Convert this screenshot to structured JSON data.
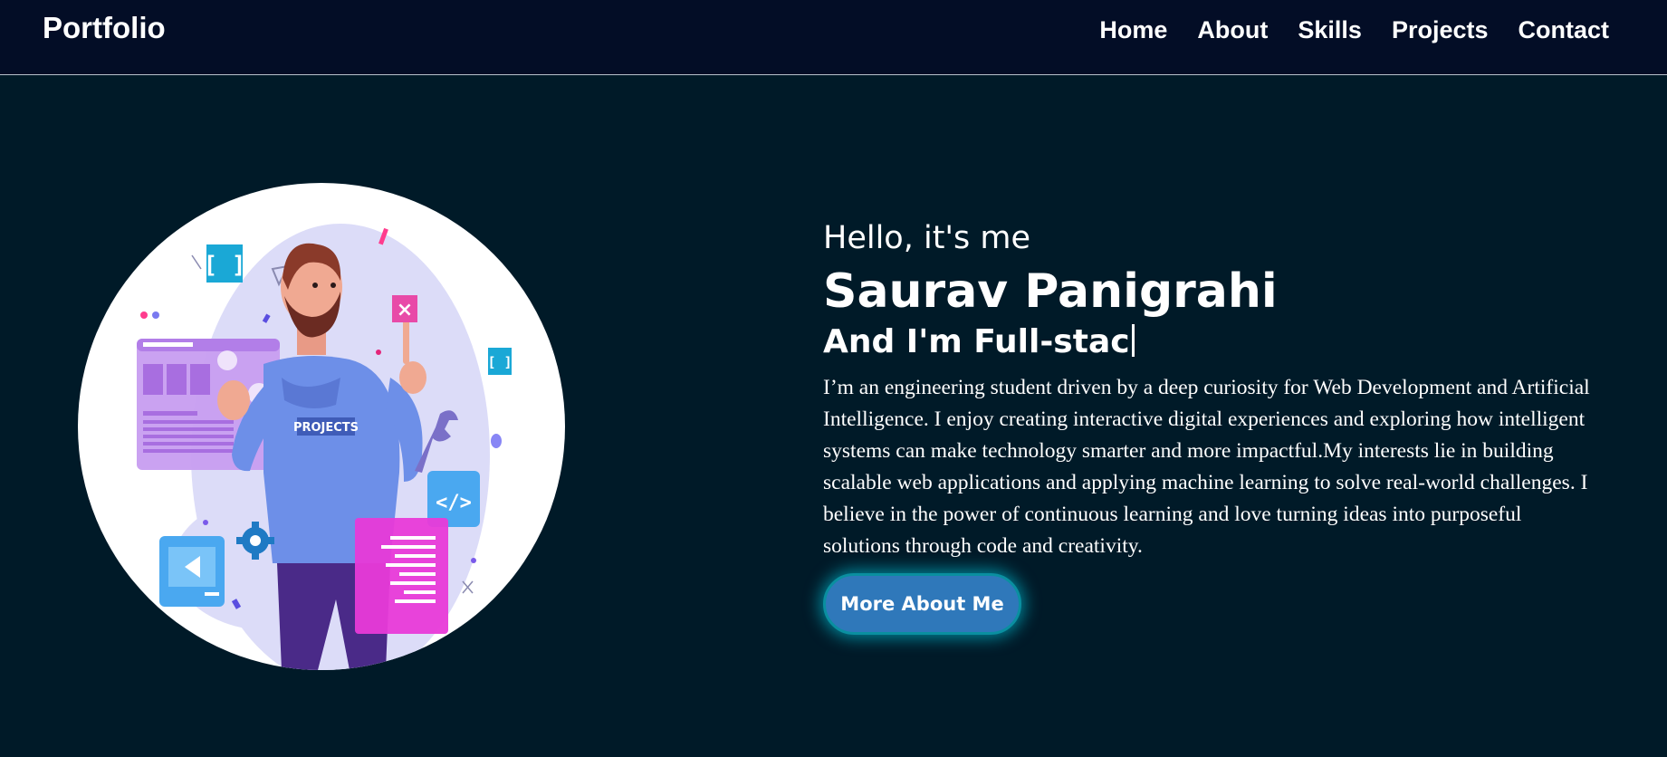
{
  "nav": {
    "logo": "Portfolio",
    "links": [
      "Home",
      "About",
      "Skills",
      "Projects",
      "Contact"
    ]
  },
  "hero": {
    "greeting": "Hello, it's me",
    "name": "Saurav Panigrahi",
    "role": "And I'm Full-stac",
    "bio": "I’m an engineering student driven by a deep curiosity for Web Development and Artificial Intelligence. I enjoy creating interactive digital experiences and exploring how intelligent systems can make technology smarter and more impactful.My interests lie in building scalable web applications and applying machine learning to solve real-world challenges. I believe in the power of continuous learning and love turning ideas into purposeful solutions through code and creativity.",
    "button_label": "More About Me",
    "illustration": {
      "shirt_label": "PROJECTS",
      "code_icon_label": "</>"
    }
  },
  "colors": {
    "page_background": "#001a28",
    "navbar_background": "#030d26",
    "button_background": "#2f78ba",
    "button_glow": "#00e6ff"
  }
}
